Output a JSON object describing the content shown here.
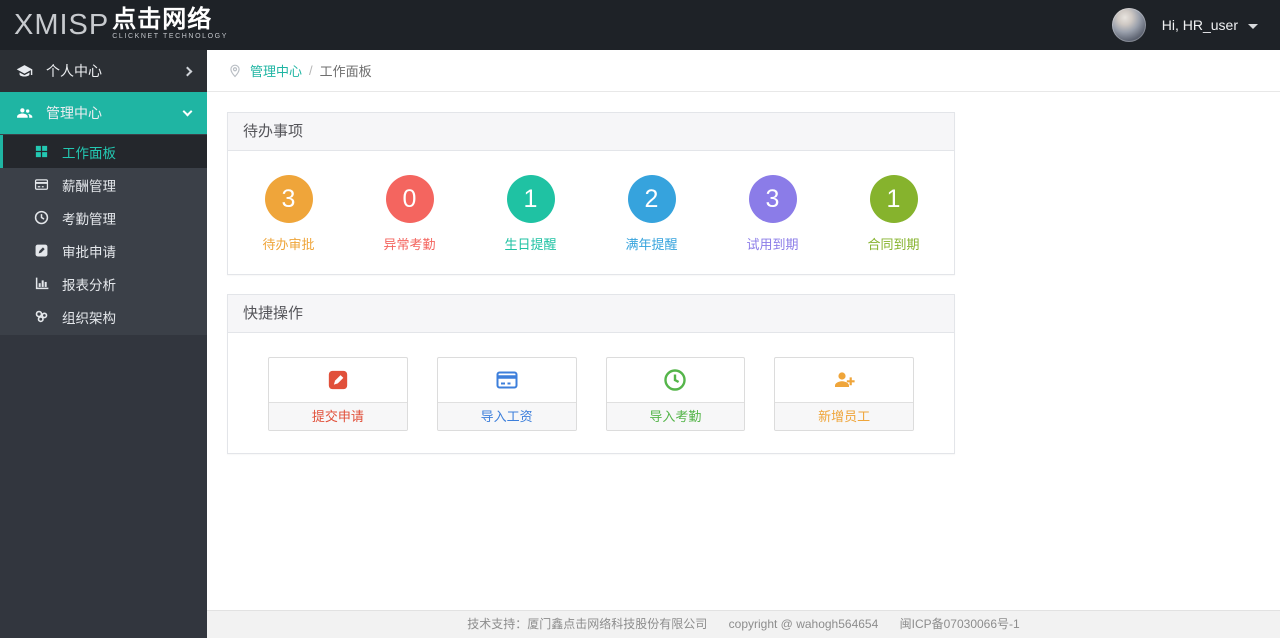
{
  "topbar": {
    "logo_en": "XMISP",
    "logo_cn": "点击网络",
    "logo_sub": "CLICKNET TECHNOLOGY",
    "greeting": "Hi, HR_user"
  },
  "sidebar": {
    "personal": {
      "label": "个人中心",
      "icon": "graduation-cap-icon"
    },
    "admin": {
      "label": "管理中心",
      "icon": "users-icon",
      "expanded": true,
      "accent_color": "#1fb5a3"
    },
    "submenu": [
      {
        "label": "工作面板",
        "icon": "grid-icon",
        "active": true
      },
      {
        "label": "薪酬管理",
        "icon": "credit-card-icon",
        "active": false
      },
      {
        "label": "考勤管理",
        "icon": "clock-icon",
        "active": false
      },
      {
        "label": "审批申请",
        "icon": "pencil-square-icon",
        "active": false
      },
      {
        "label": "报表分析",
        "icon": "bar-chart-icon",
        "active": false
      },
      {
        "label": "组织架构",
        "icon": "org-cluster-icon",
        "active": false
      }
    ]
  },
  "breadcrumb": {
    "icon": "map-pin-icon",
    "section": "管理中心",
    "separator": "/",
    "page": "工作面板"
  },
  "todo_panel": {
    "title": "待办事项",
    "items": [
      {
        "count": "3",
        "label": "待办审批",
        "color": "#efa53a"
      },
      {
        "count": "0",
        "label": "异常考勤",
        "color": "#f4655f"
      },
      {
        "count": "1",
        "label": "生日提醒",
        "color": "#1fc2a3"
      },
      {
        "count": "2",
        "label": "满年提醒",
        "color": "#36a3dd"
      },
      {
        "count": "3",
        "label": "试用到期",
        "color": "#8b7ce8"
      },
      {
        "count": "1",
        "label": "合同到期",
        "color": "#86b32d"
      }
    ]
  },
  "quick_panel": {
    "title": "快捷操作",
    "actions": [
      {
        "label": "提交申请",
        "icon": "pencil-badge-icon",
        "color": "#e1503a"
      },
      {
        "label": "导入工资",
        "icon": "credit-card-icon",
        "color": "#3d7fdb"
      },
      {
        "label": "导入考勤",
        "icon": "clock-icon",
        "color": "#55b54a"
      },
      {
        "label": "新增员工",
        "icon": "user-plus-icon",
        "color": "#efa53a"
      }
    ]
  },
  "footer": {
    "support": "技术支持：厦门鑫点击网络科技股份有限公司",
    "copyright": "copyright @ wahogh564654",
    "icp": "闽ICP备07030066号-1"
  }
}
